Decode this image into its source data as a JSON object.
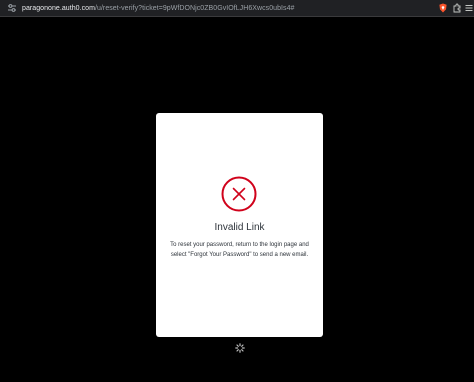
{
  "browser": {
    "url_host": "paragonone.auth0.com",
    "url_path": "/u/reset-verify?ticket=9pWfDONjc0ZB0GvIOfLJH6Xwcs0ubIs4#",
    "icons": [
      "tune-icon",
      "brave-shield-icon",
      "extensions-icon",
      "menu-icon"
    ]
  },
  "dialog": {
    "icon": "error-x-circle-icon",
    "title": "Invalid Link",
    "message": "To reset your password, return to the login page and select \"Forgot Your Password\" to send a new email."
  },
  "footer": {
    "icon": "loading-spinner-icon"
  },
  "colors": {
    "background": "#000000",
    "card": "#ffffff",
    "error": "#d0021b",
    "text": "#2d333a"
  }
}
